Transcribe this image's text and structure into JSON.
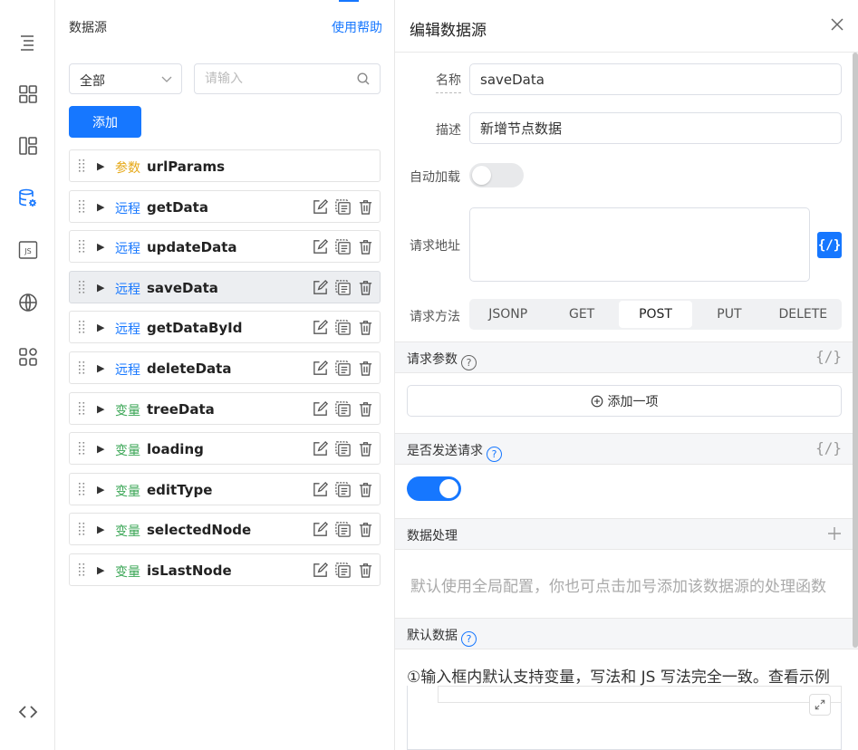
{
  "rail": {
    "icons": [
      "outline-icon",
      "components-icon",
      "layout-icon",
      "datasource-icon",
      "js-icon",
      "globe-icon",
      "apps-icon",
      "code-icon"
    ],
    "js_label": "JS",
    "accent": "#1677ff"
  },
  "datasource": {
    "title": "数据源",
    "help_link": "使用帮助",
    "filter_value": "全部",
    "search_placeholder": "请输入",
    "add_button": "添加",
    "items": [
      {
        "tag": "参数",
        "kind": "param",
        "name": "urlParams",
        "actions": false
      },
      {
        "tag": "远程",
        "kind": "remote",
        "name": "getData",
        "actions": true
      },
      {
        "tag": "远程",
        "kind": "remote",
        "name": "updateData",
        "actions": true
      },
      {
        "tag": "远程",
        "kind": "remote",
        "name": "saveData",
        "actions": true,
        "selected": true
      },
      {
        "tag": "远程",
        "kind": "remote",
        "name": "getDataById",
        "actions": true
      },
      {
        "tag": "远程",
        "kind": "remote",
        "name": "deleteData",
        "actions": true
      },
      {
        "tag": "变量",
        "kind": "var",
        "name": "treeData",
        "actions": true
      },
      {
        "tag": "变量",
        "kind": "var",
        "name": "loading",
        "actions": true
      },
      {
        "tag": "变量",
        "kind": "var",
        "name": "editType",
        "actions": true
      },
      {
        "tag": "变量",
        "kind": "var",
        "name": "selectedNode",
        "actions": true
      },
      {
        "tag": "变量",
        "kind": "var",
        "name": "isLastNode",
        "actions": true
      }
    ]
  },
  "editor": {
    "title": "编辑数据源",
    "name_label": "名称",
    "name_value": "saveData",
    "desc_label": "描述",
    "desc_value": "新增节点数据",
    "autoload_label": "自动加载",
    "autoload_on": false,
    "url_label": "请求地址",
    "url_value": "",
    "fx_label": "{/}",
    "method_label": "请求方法",
    "methods": [
      "JSONP",
      "GET",
      "POST",
      "PUT",
      "DELETE"
    ],
    "method_selected": "POST",
    "params_title": "请求参数",
    "params_fx": "{/}",
    "add_item": "添加一项",
    "send_title": "是否发送请求",
    "send_fx": "{/}",
    "send_on": true,
    "process_title": "数据处理",
    "process_hint": "默认使用全局配置，你也可点击加号添加该数据源的处理函数",
    "default_title": "默认数据",
    "default_note": "①输入框内默认支持变量，写法和 JS 写法完全一致。查看示例"
  }
}
